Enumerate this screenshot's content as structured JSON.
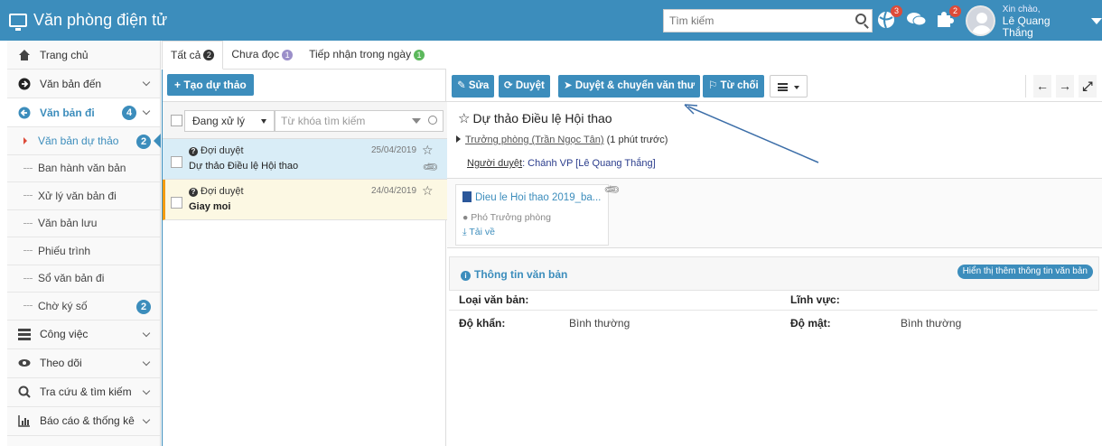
{
  "app": {
    "title": "Văn phòng điện tử"
  },
  "header": {
    "search_placeholder": "Tìm kiếm",
    "notifications": {
      "globe": "3",
      "puzzle": "2"
    },
    "greeting": "Xin chào,",
    "user_name": "Lê Quang Thắng"
  },
  "sidebar": {
    "items": [
      {
        "label": "Trang chủ",
        "icon": "home-icon"
      },
      {
        "label": "Văn bản đến",
        "icon": "arrow-circle-right-icon"
      },
      {
        "label": "Văn bản đi",
        "icon": "arrow-circle-left-icon",
        "badge": "4"
      }
    ],
    "sub_items": [
      {
        "label": "Văn bản dự thảo",
        "badge": "2",
        "current": true
      },
      {
        "label": "Ban hành văn bản"
      },
      {
        "label": "Xử lý văn bản đi"
      },
      {
        "label": "Văn bản lưu"
      },
      {
        "label": "Phiếu trình"
      },
      {
        "label": "Sổ văn bản đi"
      },
      {
        "label": "Chờ ký số",
        "badge": "2"
      }
    ],
    "bottom_items": [
      {
        "label": "Công việc",
        "icon": "tasks-icon"
      },
      {
        "label": "Theo dõi",
        "icon": "eye-icon"
      },
      {
        "label": "Tra cứu & tìm kiếm",
        "icon": "search-icon"
      },
      {
        "label": "Báo cáo & thống kê",
        "icon": "bar-chart-icon"
      }
    ]
  },
  "tabs": [
    {
      "label": "Tất cả",
      "count": "2",
      "color": "#333333"
    },
    {
      "label": "Chưa đọc",
      "count": "1",
      "color": "#9b8fc9"
    },
    {
      "label": "Tiếp nhận trong ngày",
      "count": "1",
      "color": "#5cb85c"
    }
  ],
  "list": {
    "new_button": "+ Tạo dự thảo",
    "status_filter": "Đang xử lý",
    "keyword_placeholder": "Từ khóa tìm kiếm",
    "documents": [
      {
        "status": "Đợi duyệt",
        "date": "25/04/2019",
        "title": "Dự thảo Điều lệ Hội thao"
      },
      {
        "status": "Đợi duyệt",
        "date": "24/04/2019",
        "title": "Giay moi"
      }
    ]
  },
  "toolbar": {
    "edit": "Sửa",
    "approve": "Duyệt",
    "approve_forward": "Duyệt & chuyển văn thư",
    "reject": "Từ chối"
  },
  "detail": {
    "title": "Dự thảo Điều lệ Hội thao",
    "sender": "Trưởng phòng (Trần Ngọc Tân)",
    "sent_time": "(1 phút trước)",
    "approver_label": "Người duyệt",
    "approver_value": ": Chánh VP [Lê Quang Thắng]",
    "attachment": {
      "file_name": "Dieu le Hoi thao 2019_ba...",
      "role": "Phó Trưởng phòng",
      "download": "Tải về"
    },
    "info": {
      "title": "Thông tin văn bản",
      "show_more": "Hiển thị thêm thông tin văn bản",
      "fields": {
        "doc_type_label": "Loại văn bản:",
        "doc_type_value": "",
        "field_label": "Lĩnh vực:",
        "field_value": "",
        "urgency_label": "Độ khẩn:",
        "urgency_value": "Bình thường",
        "secrecy_label": "Độ mật:",
        "secrecy_value": "Bình thường"
      }
    }
  },
  "colors": {
    "primary": "#3c8dbc",
    "badge": "#dd4b39",
    "selected_row": "#d9edf7",
    "pending_row": "#fcf8e3",
    "annotation_arrow": "#3c6ea8"
  }
}
